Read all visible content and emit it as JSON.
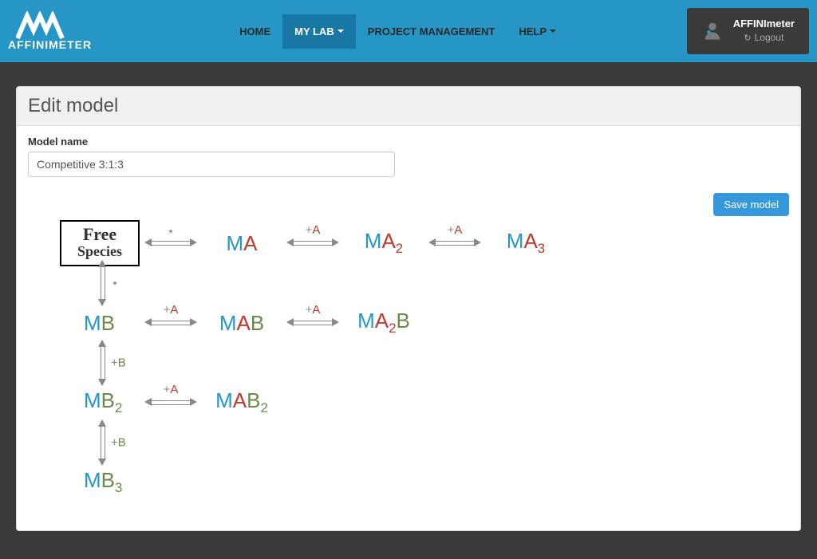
{
  "brand": "AFFINIMETER",
  "nav": {
    "home": "HOME",
    "mylab": "MY LAB",
    "projmgmt": "PROJECT MANAGEMENT",
    "help": "HELP"
  },
  "user": {
    "name": "AFFINImeter",
    "logout": "Logout"
  },
  "panel": {
    "title": "Edit model",
    "model_name_label": "Model name",
    "model_name_value": "Competitive 3:1:3",
    "save_button": "Save model"
  },
  "diagram": {
    "free_ln1": "Free",
    "free_ln2": "Species",
    "species": {
      "M": "M",
      "A": "A",
      "B": "B",
      "sub2": "2",
      "sub3": "3"
    },
    "labels": {
      "star": "⋆",
      "plusA": "+A",
      "plusB": "+B"
    }
  }
}
